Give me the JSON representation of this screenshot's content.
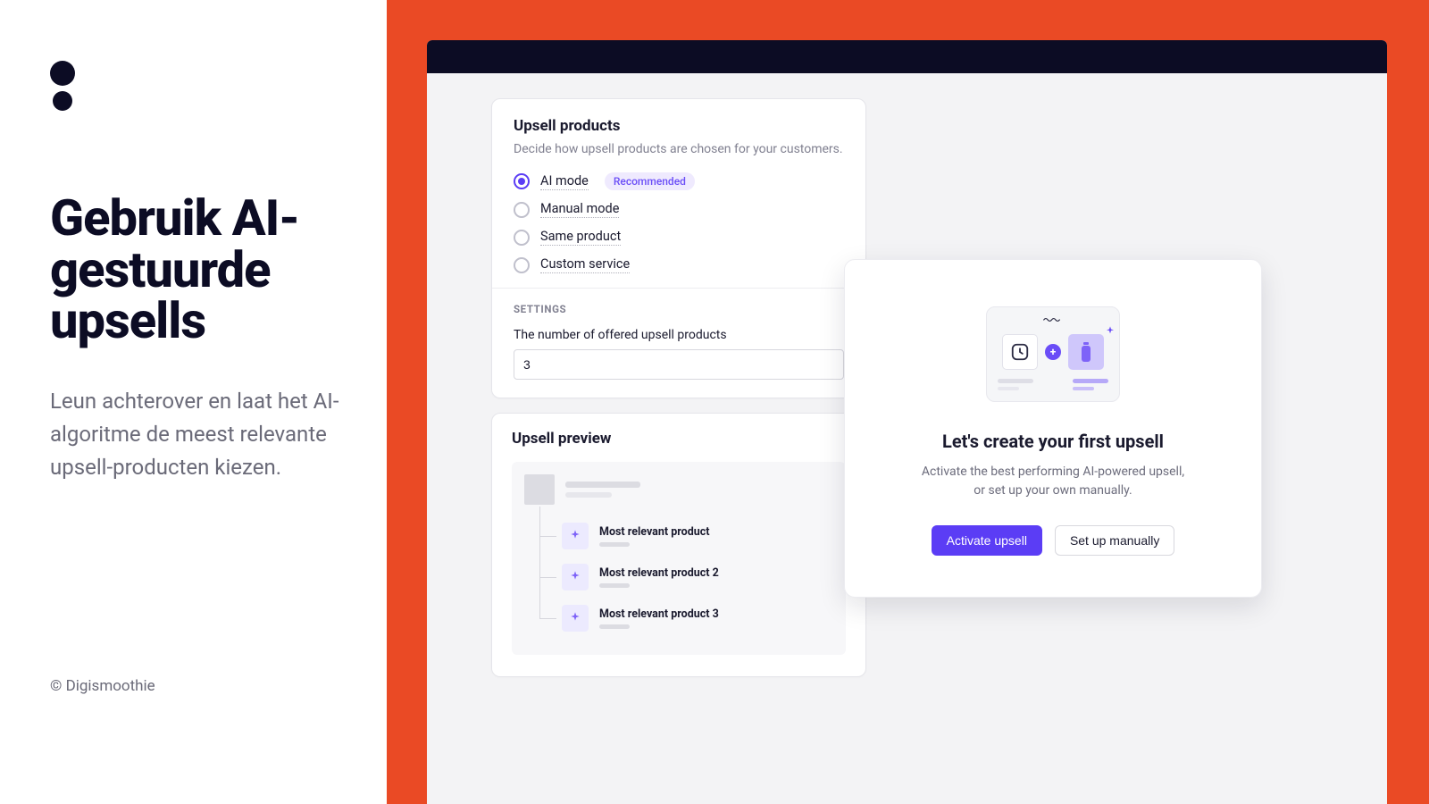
{
  "marketing": {
    "headline": "Gebruik AI-gestuurde upsells",
    "subhead": "Leun achterover en laat het AI-algoritme de meest relevante upsell-producten kiezen.",
    "copyright": "© Digismoothie"
  },
  "card_products": {
    "title": "Upsell products",
    "desc": "Decide how upsell products are chosen for your customers.",
    "options": {
      "ai": "AI mode",
      "ai_badge": "Recommended",
      "manual": "Manual mode",
      "same": "Same product",
      "custom": "Custom service"
    },
    "settings_label": "SETTINGS",
    "number_label": "The number of offered upsell products",
    "number_value": "3"
  },
  "card_preview": {
    "title": "Upsell preview",
    "items": [
      "Most relevant product",
      "Most relevant product 2",
      "Most relevant product 3"
    ]
  },
  "modal": {
    "title": "Let's create your first upsell",
    "desc_line1": "Activate the best performing AI-powered upsell,",
    "desc_line2": "or set up your own manually.",
    "primary": "Activate upsell",
    "secondary": "Set up manually"
  }
}
